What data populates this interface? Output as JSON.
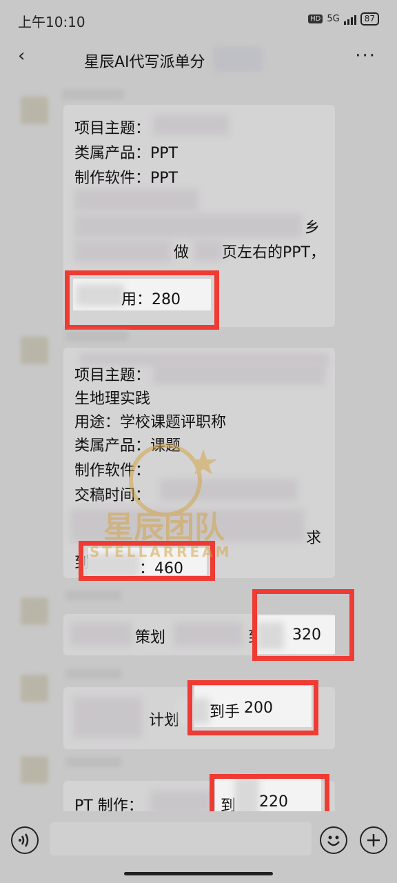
{
  "status_bar": {
    "time": "上午10:10",
    "network": "5G",
    "hd_badge": "HD",
    "battery": "87"
  },
  "header": {
    "back_icon": "back-arrow-icon",
    "title": "星辰AI代写派单分",
    "more_icon": "more-dots-icon"
  },
  "messages": [
    {
      "lines": [
        "项目主题：",
        "类属产品：PPT",
        "制作软件：PPT",
        "乡",
        "做",
        "页左右的PPT，",
        "用：280"
      ]
    },
    {
      "lines": [
        "项目主题：",
        "生地理实践",
        "用途：学校课题评职称",
        "类属产品：课题",
        "制作软件：",
        "交稿时间：",
        "求",
        "到",
        "：460"
      ]
    },
    {
      "lines": [
        "策划",
        "到手",
        "320"
      ]
    },
    {
      "lines": [
        "计划",
        "到手",
        "200"
      ]
    },
    {
      "lines": [
        "PT 制作：",
        "到",
        "220"
      ]
    }
  ],
  "watermark": {
    "main": "星辰团队",
    "sub": "STELLARREAM"
  },
  "input_bar": {
    "voice_icon": "voice-icon",
    "emoji_icon": "emoji-icon",
    "plus_icon": "plus-icon"
  },
  "colors": {
    "highlight_box": "#ee3b34",
    "overlay_bg": "#c8c8c8",
    "watermark": "#d4a54a"
  }
}
